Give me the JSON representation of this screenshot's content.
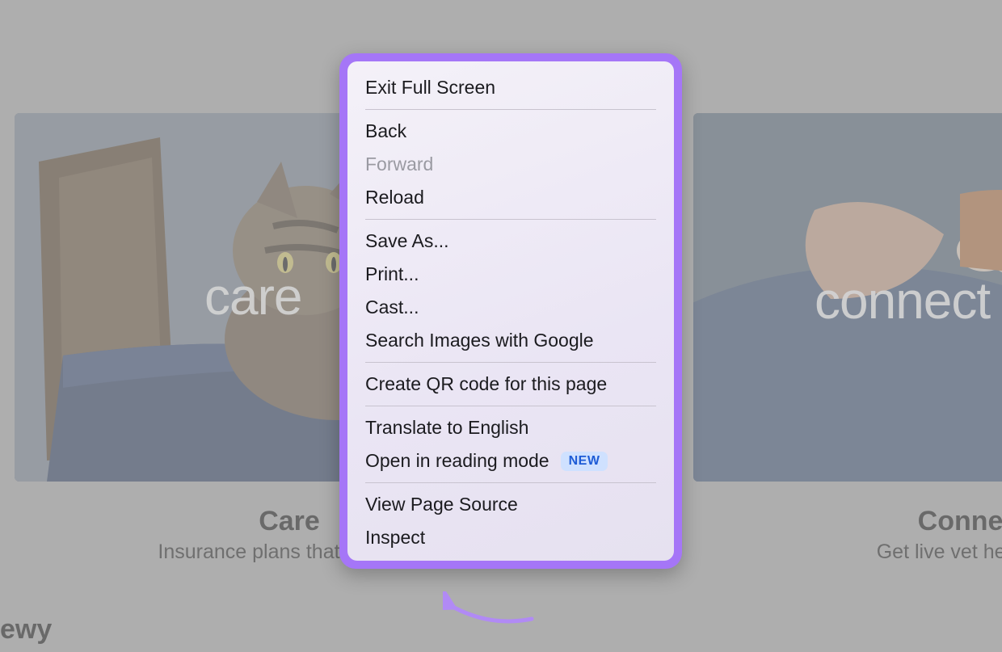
{
  "cards": {
    "left": {
      "overlay_text": "care",
      "title": "Care",
      "subtitle": "Insurance plans that give you"
    },
    "right": {
      "overlay_text": "connect",
      "title": "Connec",
      "subtitle": "Get live vet help in a"
    }
  },
  "brand_fragment": "ewy",
  "context_menu": {
    "exit_fullscreen": "Exit Full Screen",
    "back": "Back",
    "forward": "Forward",
    "reload": "Reload",
    "save_as": "Save As...",
    "print": "Print...",
    "cast": "Cast...",
    "search_images": "Search Images with Google",
    "create_qr": "Create QR code for this page",
    "translate": "Translate to English",
    "reading_mode": "Open in reading mode",
    "reading_mode_badge": "NEW",
    "view_source": "View Page Source",
    "inspect": "Inspect"
  },
  "colors": {
    "highlight_border": "#a576f7",
    "badge_bg": "#cfe1ff",
    "badge_fg": "#1e5cd6"
  }
}
